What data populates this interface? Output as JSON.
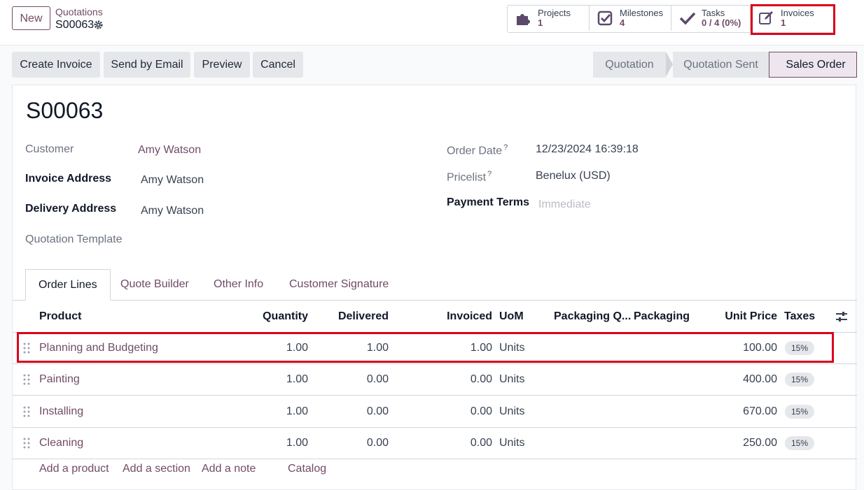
{
  "control_panel": {
    "new_label": "New",
    "breadcrumb": "Quotations",
    "record_name": "S00063",
    "smart_buttons": [
      {
        "label": "Projects",
        "value": "1",
        "icon": "puzzle-icon"
      },
      {
        "label": "Milestones",
        "value": "4",
        "icon": "check-square-icon"
      },
      {
        "label": "Tasks",
        "value": "0 / 4 (0%)",
        "icon": "check-icon"
      },
      {
        "label": "Invoices",
        "value": "1",
        "icon": "edit-icon"
      }
    ]
  },
  "actions": {
    "create_invoice": "Create Invoice",
    "send_by_email": "Send by Email",
    "preview": "Preview",
    "cancel": "Cancel"
  },
  "status": {
    "stages": [
      "Quotation",
      "Quotation Sent",
      "Sales Order"
    ],
    "active": "Sales Order"
  },
  "form": {
    "title": "S00063",
    "customer_label": "Customer",
    "customer_value": "Amy Watson",
    "invoice_address_label": "Invoice Address",
    "invoice_address_value": "Amy Watson",
    "delivery_address_label": "Delivery Address",
    "delivery_address_value": "Amy Watson",
    "quotation_template_label": "Quotation Template",
    "order_date_label": "Order Date",
    "order_date_value": "12/23/2024 16:39:18",
    "pricelist_label": "Pricelist",
    "pricelist_value": "Benelux (USD)",
    "payment_terms_label": "Payment Terms",
    "payment_terms_placeholder": "Immediate",
    "help_mark": "?"
  },
  "tabs": [
    "Order Lines",
    "Quote Builder",
    "Other Info",
    "Customer Signature"
  ],
  "table": {
    "headers": {
      "product": "Product",
      "quantity": "Quantity",
      "delivered": "Delivered",
      "invoiced": "Invoiced",
      "uom": "UoM",
      "packaging_qty": "Packaging Q...",
      "packaging": "Packaging",
      "unit_price": "Unit Price",
      "taxes": "Taxes"
    },
    "rows": [
      {
        "product": "Planning and Budgeting",
        "quantity": "1.00",
        "delivered": "1.00",
        "invoiced": "1.00",
        "uom": "Units",
        "unit_price": "100.00",
        "tax": "15%"
      },
      {
        "product": "Painting",
        "quantity": "1.00",
        "delivered": "0.00",
        "invoiced": "0.00",
        "uom": "Units",
        "unit_price": "400.00",
        "tax": "15%"
      },
      {
        "product": "Installing",
        "quantity": "1.00",
        "delivered": "0.00",
        "invoiced": "0.00",
        "uom": "Units",
        "unit_price": "670.00",
        "tax": "15%"
      },
      {
        "product": "Cleaning",
        "quantity": "1.00",
        "delivered": "0.00",
        "invoiced": "0.00",
        "uom": "Units",
        "unit_price": "250.00",
        "tax": "15%"
      }
    ],
    "add_links": [
      "Add a product",
      "Add a section",
      "Add a note",
      "Catalog"
    ]
  },
  "colors": {
    "brand": "#714b67",
    "highlight": "#d9001b"
  }
}
